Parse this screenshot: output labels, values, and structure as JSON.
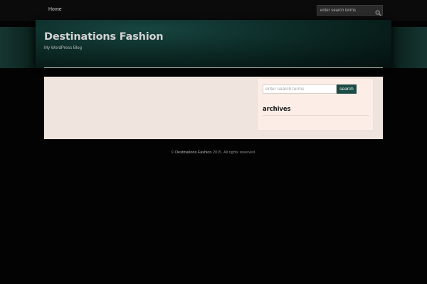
{
  "nav": {
    "home_label": "Home",
    "search_placeholder": "enter search terms",
    "search_icon": "magnifier-icon"
  },
  "header": {
    "site_title": "Destinations Fashion",
    "tagline": "My WordPress Blog"
  },
  "sidebar": {
    "search_placeholder": "enter search terms",
    "search_button_label": "search",
    "archives_heading": "archives"
  },
  "footer": {
    "copyright_symbol": "©",
    "site_link_text": "Destinations Fashion",
    "rest_text": "2015. All rights reserved."
  },
  "colors": {
    "page_background": "#030303",
    "header_accent": "#184540",
    "content_background": "#f0e4de",
    "sidebar_background": "#fcede7",
    "button_background": "#1b4b45"
  }
}
